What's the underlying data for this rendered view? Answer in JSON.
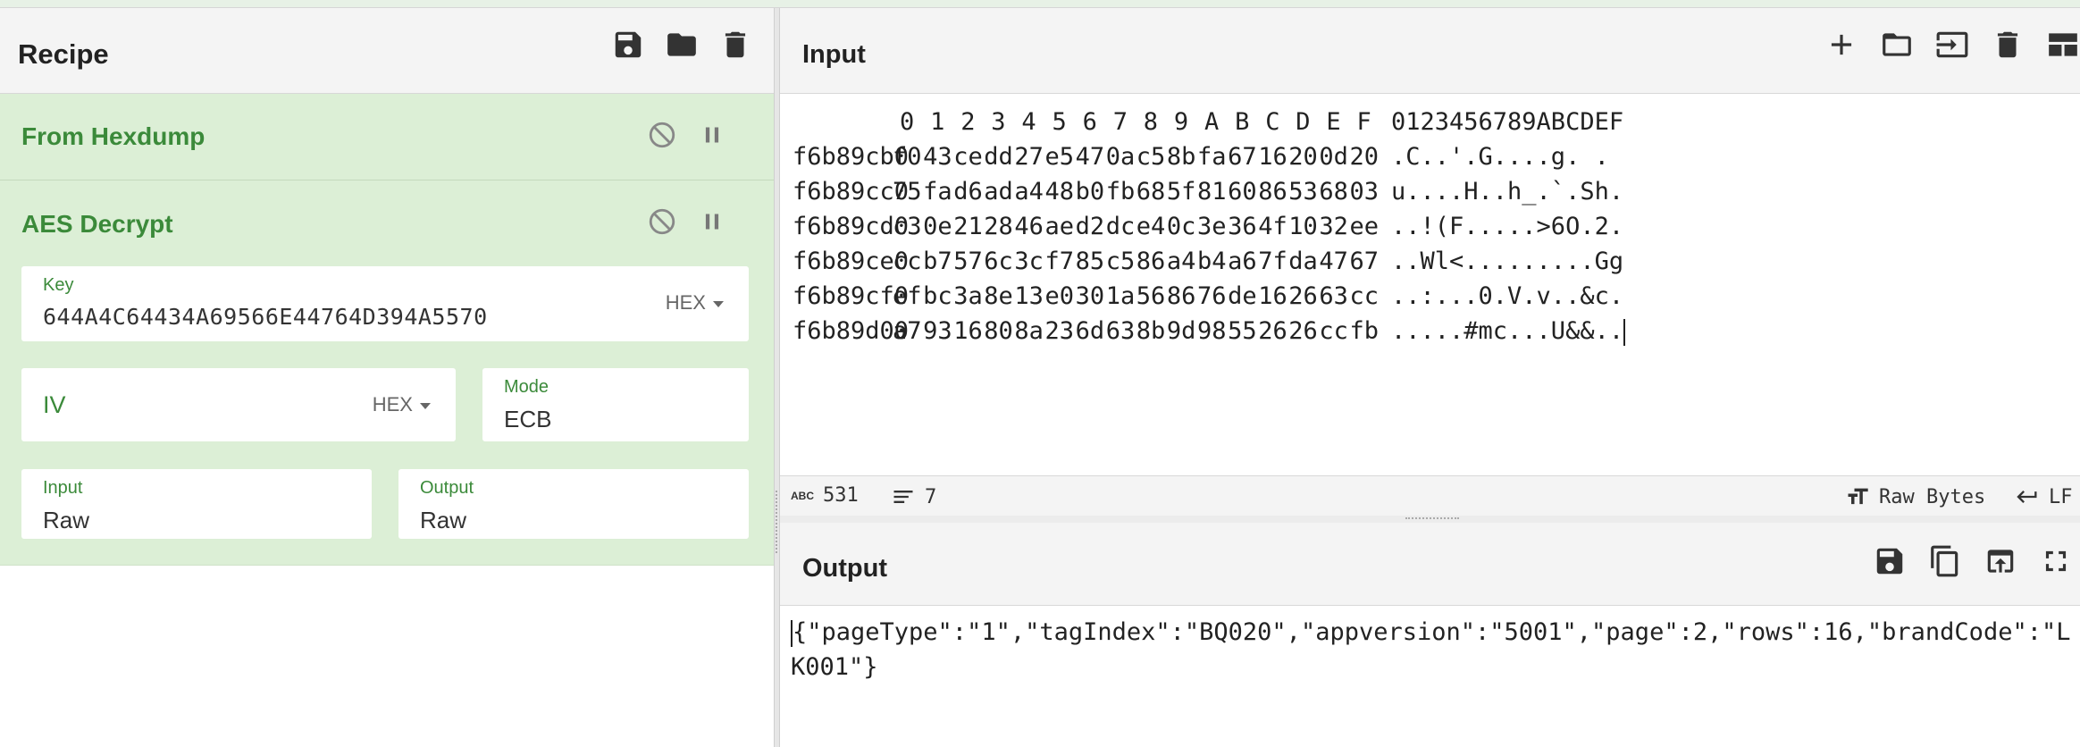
{
  "recipe": {
    "title": "Recipe",
    "operations": [
      {
        "name": "From Hexdump"
      },
      {
        "name": "AES Decrypt",
        "key": {
          "label": "Key",
          "value": "644A4C64434A69566E44764D394A5570",
          "format": "HEX"
        },
        "iv": {
          "placeholder": "IV",
          "format": "HEX"
        },
        "mode": {
          "label": "Mode",
          "value": "ECB"
        },
        "input": {
          "label": "Input",
          "value": "Raw"
        },
        "output": {
          "label": "Output",
          "value": "Raw"
        }
      }
    ]
  },
  "input": {
    "title": "Input",
    "hexdump": {
      "header_cols": [
        "0",
        "1",
        "2",
        "3",
        "4",
        "5",
        "6",
        "7",
        "8",
        "9",
        "A",
        "B",
        "C",
        "D",
        "E",
        "F"
      ],
      "header_ascii": "0123456789ABCDEF",
      "rows": [
        {
          "offset": "f6b89cb0",
          "bytes": [
            "f0",
            "43",
            "ce",
            "dd",
            "27",
            "e5",
            "47",
            "0a",
            "c5",
            "8b",
            "fa",
            "67",
            "16",
            "20",
            "0d",
            "20"
          ],
          "ascii": ".C..'.G....g. ."
        },
        {
          "offset": "f6b89cc0",
          "bytes": [
            "75",
            "fa",
            "d6",
            "ad",
            "a4",
            "48",
            "b0",
            "fb",
            "68",
            "5f",
            "81",
            "60",
            "86",
            "53",
            "68",
            "03"
          ],
          "ascii": "u....H..h_.`.Sh."
        },
        {
          "offset": "f6b89cd0",
          "bytes": [
            "c3",
            "0e",
            "21",
            "28",
            "46",
            "ae",
            "d2",
            "dc",
            "e4",
            "0c",
            "3e",
            "36",
            "4f",
            "10",
            "32",
            "ee"
          ],
          "ascii": "..!(F.....>6O.2."
        },
        {
          "offset": "f6b89ce0",
          "bytes": [
            "cc",
            "b7",
            "57",
            "6c",
            "3c",
            "f7",
            "85",
            "c5",
            "86",
            "a4",
            "b4",
            "a6",
            "7f",
            "da",
            "47",
            "67"
          ],
          "ascii": "..Wl<.........Gg"
        },
        {
          "offset": "f6b89cf0",
          "bytes": [
            "ef",
            "bc",
            "3a",
            "8e",
            "13",
            "e0",
            "30",
            "1a",
            "56",
            "86",
            "76",
            "de",
            "16",
            "26",
            "63",
            "cc"
          ],
          "ascii": "..:...0.V.v..&c."
        },
        {
          "offset": "f6b89d00",
          "bytes": [
            "a7",
            "93",
            "16",
            "80",
            "8a",
            "23",
            "6d",
            "63",
            "8b",
            "9d",
            "98",
            "55",
            "26",
            "26",
            "cc",
            "fb"
          ],
          "ascii": ".....#mc...U&&.."
        }
      ]
    },
    "status": {
      "abc_icon": "ABC",
      "length": "531",
      "lines": "7",
      "encoding": "Raw Bytes",
      "eol": "LF"
    }
  },
  "output": {
    "title": "Output",
    "text": "{\"pageType\":\"1\",\"tagIndex\":\"BQ020\",\"appversion\":\"5001\",\"page\":2,\"rows\":16,\"brandCode\":\"LK001\"}"
  }
}
